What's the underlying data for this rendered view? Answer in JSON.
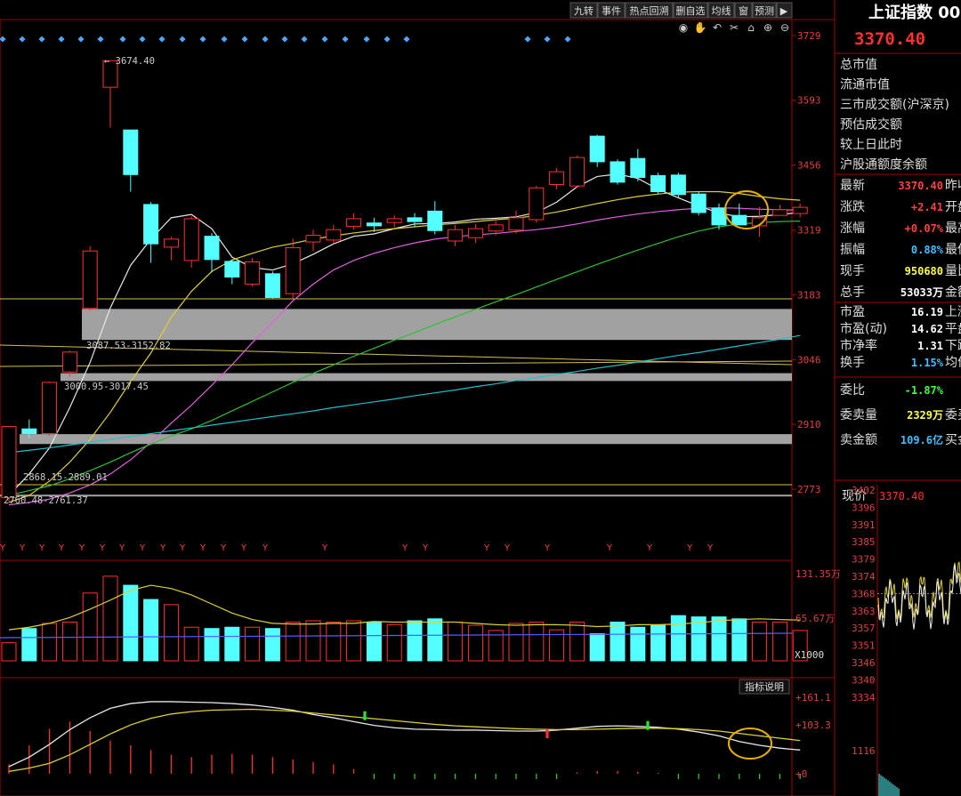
{
  "toolbar": {
    "buttons": [
      "九转",
      "事件",
      "热点回溯",
      "删自选",
      "均线",
      "窗",
      "预测"
    ],
    "arrow": "▶"
  },
  "chart_tools": [
    "eye-icon",
    "hand-icon",
    "undo-icon",
    "scissors-icon",
    "lock-icon",
    "zoom-in-icon",
    "zoom-out-icon"
  ],
  "main_axis": {
    "ticks": [
      "3729",
      "3593",
      "3456",
      "3319",
      "3183",
      "3046",
      "2910",
      "2773"
    ]
  },
  "volume_axis": {
    "ticks": [
      "131.35万",
      "65.67万"
    ],
    "unit": "X1000"
  },
  "indicator_axis": {
    "ticks": [
      "+161.1",
      "+103.3",
      "+0"
    ],
    "button": "指标说明"
  },
  "annotations": {
    "high": "3674.40",
    "gap1": "3087.53-3152.82",
    "gap2": "3000.95-3017.45",
    "gap3": "2868.15-2889.01",
    "gap4": "2760.48-2761.37"
  },
  "signal_marker": "Y",
  "right_panel": {
    "title": "上证指数 00",
    "price": "3370.40",
    "market_rows": [
      "总市值",
      "流通市值",
      "三市成交额(沪深京)",
      "预估成交额",
      "较上日此时",
      "沪股通额度余额"
    ],
    "quote_rows": [
      {
        "label": "最新",
        "value": "3370.40",
        "extra": "昨收",
        "color": "#ff4040"
      },
      {
        "label": "涨跌",
        "value": "+2.41",
        "extra": "开盘",
        "color": "#ff4040"
      },
      {
        "label": "涨幅",
        "value": "+0.07%",
        "extra": "最高",
        "color": "#ff4040"
      },
      {
        "label": "振幅",
        "value": "0.88%",
        "extra": "最低",
        "color": "#40c0ff"
      },
      {
        "label": "现手",
        "value": "950680",
        "extra": "量比",
        "color": "#ffff40"
      },
      {
        "label": "总手",
        "value": "53033万",
        "extra": "金额",
        "color": "#ffffff"
      }
    ],
    "valuation_rows": [
      {
        "label": "市盈",
        "value": "16.19",
        "extra": "上涨",
        "color": "#ffffff"
      },
      {
        "label": "市盈(动)",
        "value": "14.62",
        "extra": "平盘",
        "color": "#ffffff"
      },
      {
        "label": "市净率",
        "value": "1.31",
        "extra": "下跌",
        "color": "#ffffff"
      },
      {
        "label": "换手",
        "value": "1.15%",
        "extra": "均价",
        "color": "#40c0ff"
      }
    ],
    "order_rows": [
      {
        "label": "委比",
        "value": "-1.87%",
        "extra": "",
        "color": "#40ff40"
      },
      {
        "label": "委卖量",
        "value": "2329万",
        "extra": "委买",
        "color": "#ffff40"
      },
      {
        "label": "卖金额",
        "value": "109.6亿",
        "extra": "买金",
        "color": "#40c0ff"
      }
    ],
    "current_price_label": "现价",
    "current_price_value": "3370.40",
    "minute_axis": [
      "3402",
      "3396",
      "3391",
      "3385",
      "3379",
      "3374",
      "3368",
      "3363",
      "3357",
      "3351",
      "3346",
      "3340",
      "3334",
      "1116"
    ]
  },
  "chart_data": {
    "type": "candlestick",
    "price_axis_range": [
      2745,
      3765
    ],
    "candles": [
      [
        2755,
        2905,
        2745,
        2900
      ],
      [
        2900,
        2890,
        2880,
        2920
      ],
      [
        2890,
        2998,
        2885,
        3000
      ],
      [
        3020,
        3062,
        3010,
        3065
      ],
      [
        3154,
        3275,
        3150,
        3285
      ],
      [
        3620,
        3676,
        3535,
        3674
      ],
      [
        3530,
        3436,
        3400,
        3440
      ],
      [
        3373,
        3290,
        3250,
        3378
      ],
      [
        3283,
        3300,
        3255,
        3305
      ],
      [
        3255,
        3343,
        3240,
        3348
      ],
      [
        3306,
        3257,
        3230,
        3313
      ],
      [
        3253,
        3220,
        3205,
        3257
      ],
      [
        3205,
        3252,
        3200,
        3260
      ],
      [
        3227,
        3177,
        3175,
        3232
      ],
      [
        3185,
        3282,
        3175,
        3301
      ],
      [
        3294,
        3308,
        3275,
        3320
      ],
      [
        3298,
        3320,
        3290,
        3330
      ],
      [
        3327,
        3343,
        3320,
        3355
      ],
      [
        3334,
        3328,
        3315,
        3345
      ],
      [
        3335,
        3343,
        3325,
        3350
      ],
      [
        3345,
        3337,
        3325,
        3355
      ],
      [
        3359,
        3318,
        3310,
        3380
      ],
      [
        3296,
        3320,
        3285,
        3330
      ],
      [
        3303,
        3322,
        3292,
        3332
      ],
      [
        3317,
        3330,
        3308,
        3338
      ],
      [
        3319,
        3345,
        3312,
        3360
      ],
      [
        3341,
        3408,
        3335,
        3412
      ],
      [
        3415,
        3442,
        3405,
        3450
      ],
      [
        3412,
        3472,
        3408,
        3476
      ],
      [
        3517,
        3463,
        3452,
        3520
      ],
      [
        3463,
        3420,
        3415,
        3468
      ],
      [
        3470,
        3430,
        3422,
        3490
      ],
      [
        3434,
        3400,
        3395,
        3440
      ],
      [
        3435,
        3394,
        3388,
        3440
      ],
      [
        3395,
        3356,
        3350,
        3400
      ],
      [
        3365,
        3330,
        3320,
        3375
      ],
      [
        3350,
        3330,
        3330,
        3375
      ],
      [
        3328,
        3345,
        3305,
        3368
      ],
      [
        3350,
        3362,
        3349,
        3372
      ],
      [
        3354,
        3367,
        3346,
        3375
      ]
    ],
    "moving_averages": {
      "ma5_white": [
        2760,
        2805,
        2860,
        2945,
        3040,
        3155,
        3245,
        3300,
        3345,
        3352,
        3322,
        3262,
        3240,
        3235,
        3248,
        3268,
        3290,
        3306,
        3311,
        3322,
        3332,
        3333,
        3336,
        3342,
        3344,
        3347,
        3356,
        3378,
        3410,
        3432,
        3437,
        3428,
        3405,
        3387,
        3370,
        3355,
        3347,
        3348,
        3352,
        3356
      ],
      "ma10_yellow": [
        2745,
        2760,
        2790,
        2830,
        2878,
        2935,
        3000,
        3060,
        3135,
        3190,
        3232,
        3256,
        3270,
        3283,
        3291,
        3300,
        3307,
        3313,
        3318,
        3322,
        3326,
        3330,
        3333,
        3337,
        3341,
        3344,
        3350,
        3357,
        3366,
        3375,
        3383,
        3390,
        3395,
        3399,
        3400,
        3400,
        3396,
        3390,
        3385,
        3382
      ],
      "ma20_purple": [
        2740,
        2745,
        2752,
        2765,
        2782,
        2805,
        2835,
        2872,
        2912,
        2950,
        2992,
        3035,
        3082,
        3125,
        3170,
        3205,
        3235,
        3255,
        3270,
        3282,
        3292,
        3300,
        3305,
        3309,
        3312,
        3316,
        3320,
        3325,
        3332,
        3340,
        3347,
        3353,
        3358,
        3362,
        3365,
        3366,
        3365,
        3363,
        3362,
        3361
      ],
      "ma60_green": [
        2760,
        2770,
        2780,
        2795,
        2812,
        2830,
        2850,
        2868,
        2885,
        2900,
        2918,
        2938,
        2958,
        2978,
        2998,
        3017,
        3035,
        3053,
        3070,
        3087,
        3103,
        3120,
        3136,
        3152,
        3168,
        3183,
        3199,
        3215,
        3231,
        3247,
        3262,
        3277,
        3291,
        3305,
        3317,
        3326,
        3332,
        3335,
        3337,
        3338
      ],
      "ma120_cyan": [
        2850,
        2855,
        2860,
        2866,
        2872,
        2878,
        2884,
        2890,
        2896,
        2902,
        2908,
        2914,
        2920,
        2926,
        2932,
        2938,
        2945,
        2951,
        2957,
        2963,
        2970,
        2976,
        2982,
        2989,
        2995,
        3002,
        3008,
        3015,
        3021,
        3028,
        3034,
        3041,
        3048,
        3055,
        3061,
        3068,
        3075,
        3082,
        3089,
        3097
      ]
    },
    "volume_axis_range": [
      0,
      135
    ],
    "volumes": [
      28,
      50,
      58,
      60,
      105,
      131,
      117,
      95,
      87,
      52,
      50,
      52,
      52,
      50,
      60,
      62,
      60,
      62,
      60,
      56,
      62,
      65,
      60,
      55,
      47,
      58,
      60,
      48,
      60,
      42,
      60,
      52,
      55,
      70,
      68,
      68,
      65,
      60,
      60,
      47
    ],
    "volume_ma": [
      48,
      52,
      58,
      67,
      80,
      94,
      109,
      117,
      112,
      102,
      88,
      74,
      64,
      58,
      57,
      57,
      58,
      58,
      61,
      60,
      60,
      60,
      60,
      58,
      56,
      55,
      56,
      56,
      55,
      53,
      54,
      56,
      56,
      57,
      59,
      62,
      64,
      65,
      64,
      63
    ],
    "indicator_range": [
      0,
      165
    ],
    "macd_dif": [
      15,
      35,
      62,
      93,
      118,
      138,
      148,
      152,
      152,
      151,
      150,
      148,
      145,
      140,
      134,
      125,
      118,
      110,
      102,
      97,
      94,
      93,
      92,
      92,
      91,
      90,
      90,
      92,
      96,
      100,
      101,
      100,
      98,
      94,
      88,
      80,
      68,
      60,
      54,
      50
    ],
    "macd_dea": [
      5,
      12,
      22,
      40,
      62,
      84,
      103,
      117,
      126,
      131,
      134,
      135,
      136,
      134,
      132,
      128,
      124,
      120,
      116,
      112,
      108,
      104,
      101,
      99,
      97,
      95,
      94,
      93,
      93,
      94,
      95,
      96,
      96,
      95,
      93,
      90,
      85,
      80,
      75,
      70
    ],
    "macd_bars": [
      20,
      60,
      95,
      110,
      90,
      70,
      60,
      50,
      40,
      35,
      40,
      42,
      40,
      35,
      30,
      25,
      20,
      10,
      -5,
      -10,
      -8,
      -12,
      -14,
      -10,
      -8,
      -6,
      -4,
      -2,
      3,
      6,
      6,
      4,
      2,
      -3,
      -8,
      -12,
      -16,
      -20,
      -20,
      -18
    ]
  }
}
